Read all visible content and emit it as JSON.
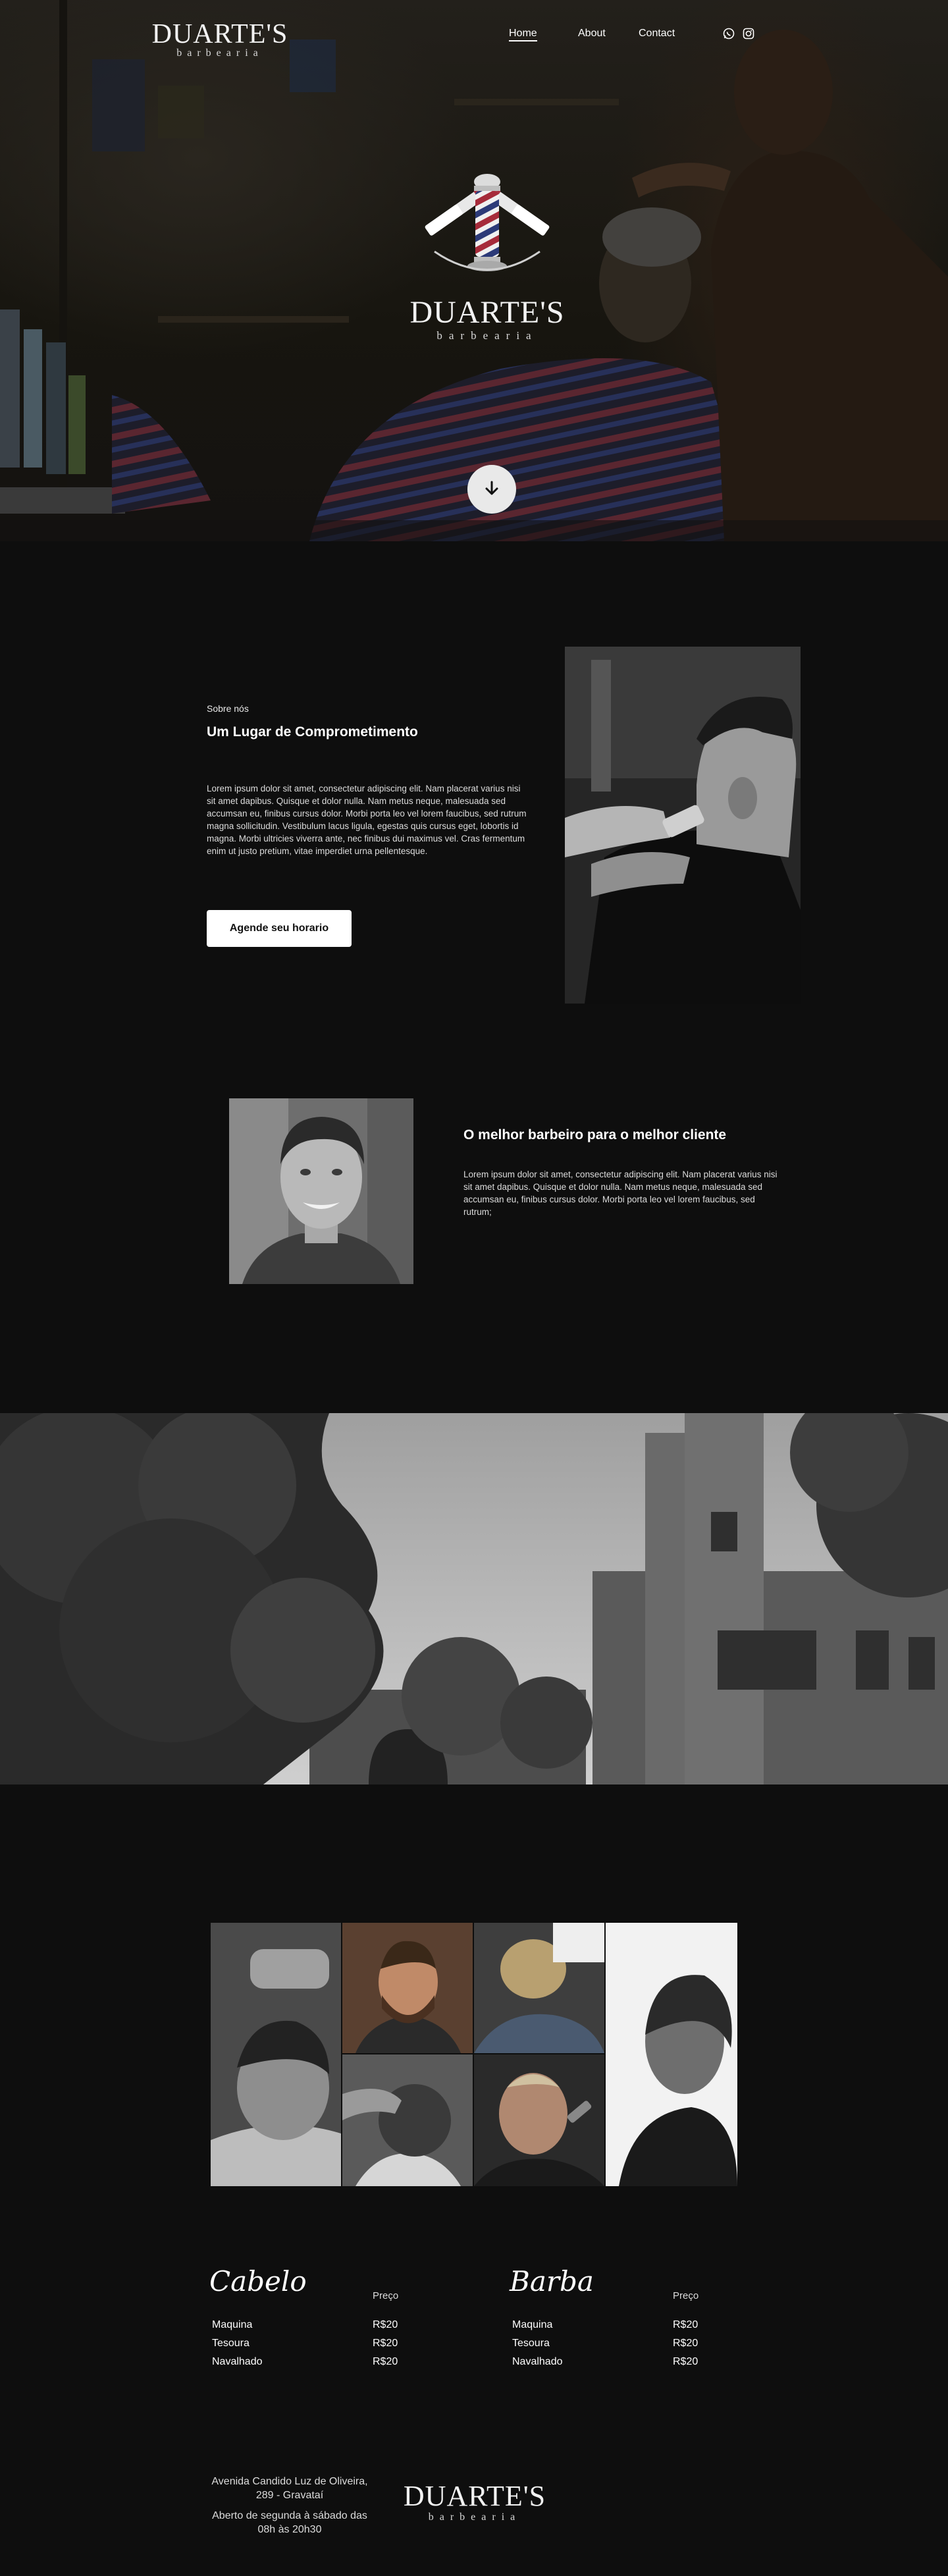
{
  "nav": {
    "logo": {
      "word": "DUARTE'S",
      "sub": "barbearia"
    },
    "links": [
      "Home",
      "About",
      "Contact"
    ],
    "icons": [
      "whatsapp-icon",
      "instagram-icon"
    ]
  },
  "hero": {
    "logo": {
      "word": "DUARTE'S",
      "sub": "barbearia"
    },
    "scroll_icon": "arrow-down-icon"
  },
  "about": {
    "eyebrow": "Sobre nós",
    "title": "Um Lugar de Comprometimento",
    "body": "Lorem ipsum dolor sit amet, consectetur adipiscing elit. Nam placerat varius nisi sit amet dapibus. Quisque et dolor nulla. Nam metus neque, malesuada sed accumsan eu, finibus cursus dolor. Morbi porta leo vel lorem faucibus, sed rutrum magna sollicitudin. Vestibulum lacus ligula, egestas quis cursus eget, lobortis id magna. Morbi ultricies viverra ante, nec finibus dui maximus vel. Cras fermentum enim ut justo pretium, vitae imperdiet urna pellentesque.",
    "cta": "Agende seu horario"
  },
  "barber": {
    "title": "O melhor barbeiro para o melhor cliente",
    "body": "Lorem ipsum dolor sit amet, consectetur adipiscing elit. Nam placerat varius nisi sit amet dapibus. Quisque et dolor nulla. Nam metus neque, malesuada sed accumsan eu, finibus cursus dolor. Morbi porta leo vel lorem faucibus, sed rutrum;"
  },
  "prices": {
    "cabelo": {
      "title": "Cabelo",
      "price_header": "Preço",
      "items": [
        {
          "name": "Maquina",
          "price": "R$20"
        },
        {
          "name": "Tesoura",
          "price": "R$20"
        },
        {
          "name": "Navalhado",
          "price": "R$20"
        }
      ]
    },
    "barba": {
      "title": "Barba",
      "price_header": "Preço",
      "items": [
        {
          "name": "Maquina",
          "price": "R$20"
        },
        {
          "name": "Tesoura",
          "price": "R$20"
        },
        {
          "name": "Navalhado",
          "price": "R$20"
        }
      ]
    }
  },
  "footer": {
    "address_line1": "Avenida Candido Luz de Oliveira,",
    "address_line2": "289 - Gravataí",
    "hours_line1": "Aberto de segunda à sábado das",
    "hours_line2": "08h às 20h30",
    "logo": {
      "word": "DUARTE'S",
      "sub": "barbearia"
    }
  },
  "colors": {
    "background": "#0e0e0e",
    "pole_red": "#a62b3a",
    "pole_blue": "#2c3a78",
    "button_bg": "#ffffff"
  }
}
